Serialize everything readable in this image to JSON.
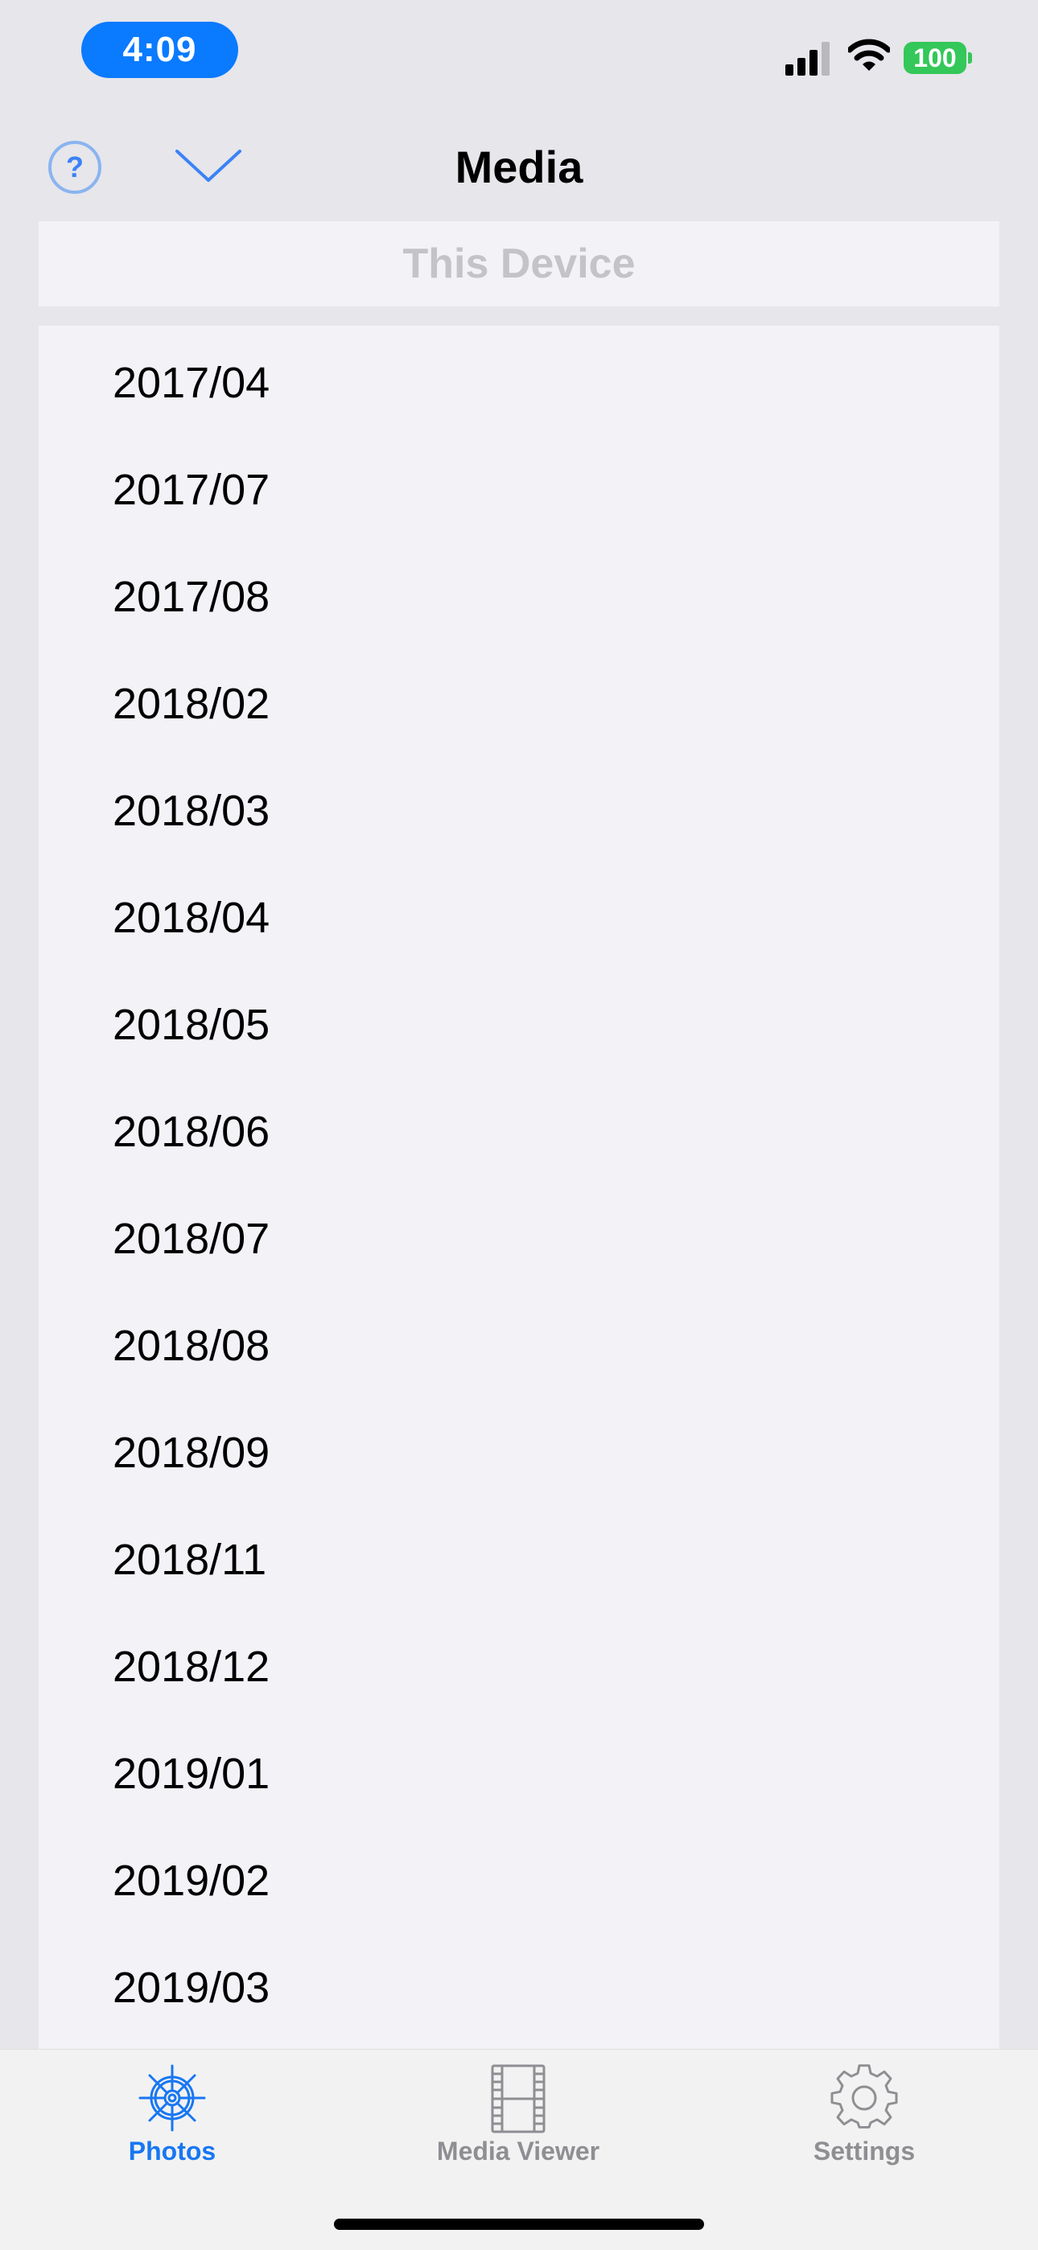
{
  "status_bar": {
    "time": "4:09",
    "battery_level": "100",
    "accent_color": "#0a7aff",
    "battery_color": "#34c759"
  },
  "nav": {
    "title": "Media",
    "help_label": "?"
  },
  "source_header": "This Device",
  "months": [
    "2017/04",
    "2017/07",
    "2017/08",
    "2018/02",
    "2018/03",
    "2018/04",
    "2018/05",
    "2018/06",
    "2018/07",
    "2018/08",
    "2018/09",
    "2018/11",
    "2018/12",
    "2019/01",
    "2019/02",
    "2019/03"
  ],
  "tabs": {
    "photos": {
      "label": "Photos",
      "icon": "ship-wheel-icon",
      "selected": true
    },
    "viewer": {
      "label": "Media Viewer",
      "icon": "film-strip-icon",
      "selected": false
    },
    "settings": {
      "label": "Settings",
      "icon": "gear-icon",
      "selected": false
    }
  }
}
